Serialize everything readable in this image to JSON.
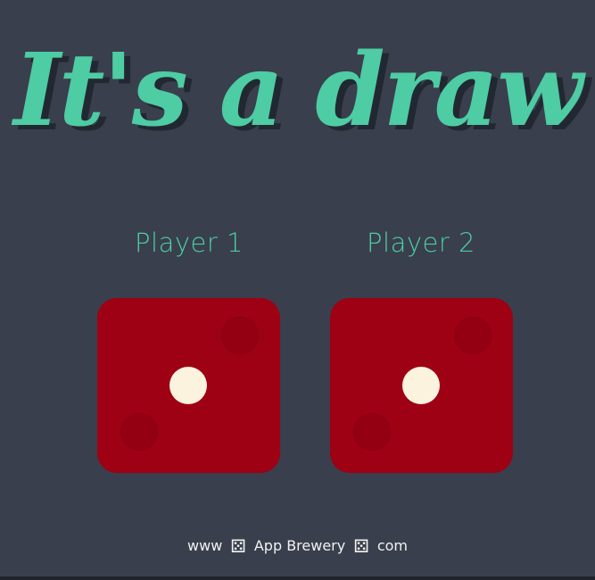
{
  "title": "It's a draw",
  "players": [
    {
      "label": "Player 1",
      "die_value": 1
    },
    {
      "label": "Player 2",
      "die_value": 1
    }
  ],
  "footer": {
    "prefix": "www",
    "brand": "App Brewery",
    "suffix": "com",
    "icon": "dice-icon"
  },
  "colors": {
    "background": "#393f4d",
    "accent": "#4ecca3",
    "die": "#9e0014",
    "pip": "#fbf3dd",
    "text_shadow": "#222831"
  }
}
